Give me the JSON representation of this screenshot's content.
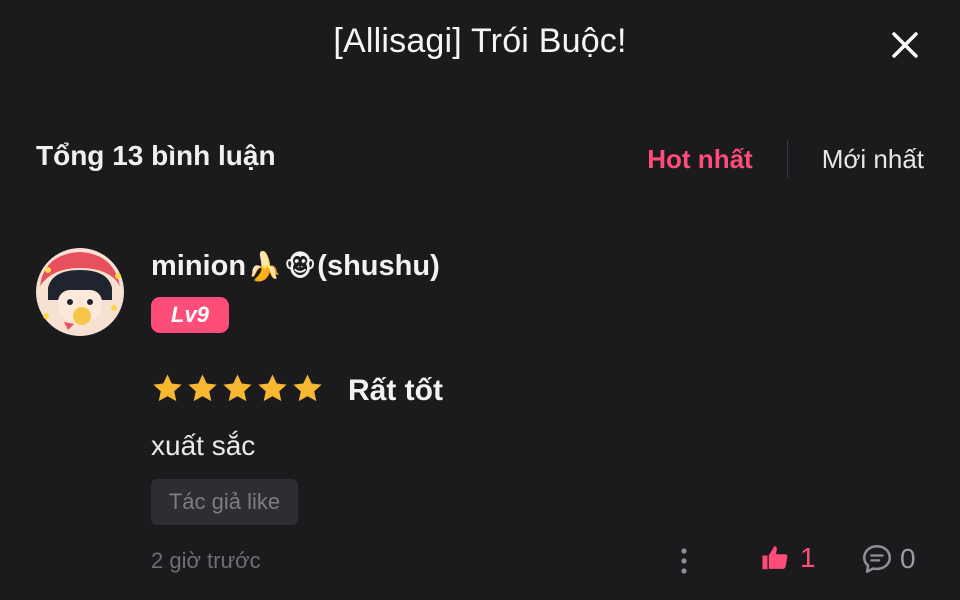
{
  "header": {
    "title": "[Allisagi] Trói Buộc!"
  },
  "summary": {
    "total": "Tổng 13 bình luận"
  },
  "sort": {
    "hot": "Hot nhất",
    "newest": "Mới nhất"
  },
  "comment": {
    "user": {
      "name_prefix": "minion",
      "emoji1": "🍌",
      "emoji2": "🐵",
      "name_suffix": "(shushu)",
      "level": "Lv9"
    },
    "rating": {
      "stars": 5,
      "label": "Rất tốt"
    },
    "text": "xuất sắc",
    "author_like_tag": "Tác giả like",
    "time": "2 giờ trước",
    "likes": "1",
    "replies": "0"
  },
  "colors": {
    "accent": "#ff4d79",
    "star": "#f7b731",
    "background": "#1b1a1d"
  },
  "icons": {
    "close": "close-icon",
    "like": "thumbs-up-icon",
    "reply": "comment-bubble-icon",
    "more": "more-vertical-icon"
  }
}
